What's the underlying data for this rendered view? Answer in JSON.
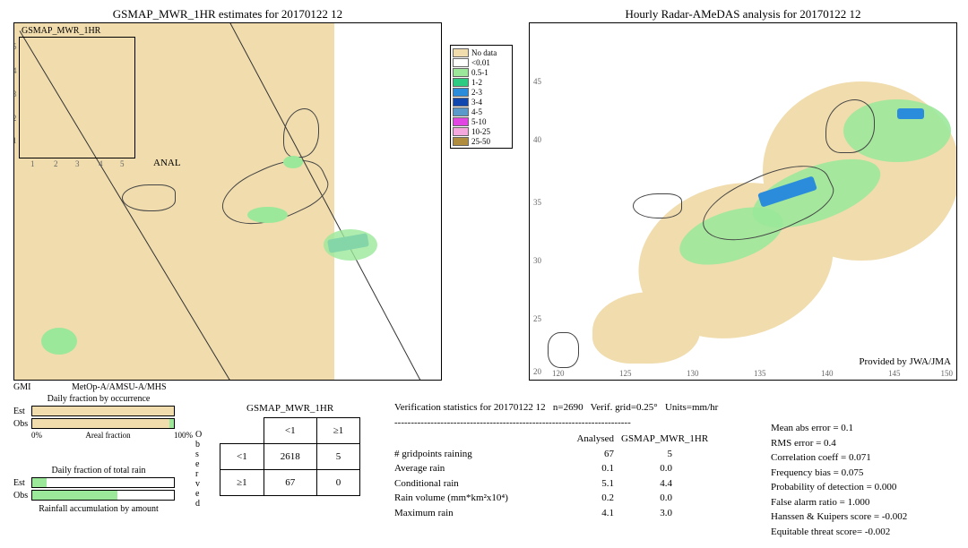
{
  "left_map": {
    "title": "GSMAP_MWR_1HR estimates for 20170122 12",
    "inset_label": "GSMAP_MWR_1HR",
    "anal_label": "ANAL",
    "footer_left": "GMI",
    "footer_right": "MetOp-A/AMSU-A/MHS"
  },
  "right_map": {
    "title": "Hourly Radar-AMeDAS analysis for 20170122 12",
    "lat_ticks": [
      "45",
      "40",
      "35",
      "30",
      "25",
      "20"
    ],
    "lon_ticks": [
      "120",
      "125",
      "130",
      "135",
      "140",
      "145",
      "150"
    ],
    "provided": "Provided by JWA/JMA"
  },
  "legend": {
    "items": [
      {
        "color": "#f0dcad",
        "label": "No data"
      },
      {
        "color": "#ffffff",
        "label": "<0.01"
      },
      {
        "color": "#9be89b",
        "label": "0.5-1"
      },
      {
        "color": "#2ecc82",
        "label": "1-2"
      },
      {
        "color": "#2b8cdb",
        "label": "2-3"
      },
      {
        "color": "#1148b0",
        "label": "3-4"
      },
      {
        "color": "#5a9acb",
        "label": "4-5"
      },
      {
        "color": "#e246e2",
        "label": "5-10"
      },
      {
        "color": "#f5a8de",
        "label": "10-25"
      },
      {
        "color": "#b08c3e",
        "label": "25-50"
      }
    ]
  },
  "bars": {
    "title1": "Daily fraction by occurrence",
    "title2": "Daily fraction of total rain",
    "caption3": "Rainfall accumulation by amount",
    "est_label": "Est",
    "obs_label": "Obs",
    "x0": "0%",
    "x1": "Areal fraction",
    "x100": "100%"
  },
  "contingency": {
    "title": "GSMAP_MWR_1HR",
    "col1": "<1",
    "col2": "≥1",
    "row1": "<1",
    "row2": "≥1",
    "c11": "2618",
    "c12": "5",
    "c21": "67",
    "c22": "0",
    "observed": "Observed"
  },
  "stats": {
    "header": "Verification statistics for 20170122 12   n=2690   Verif. grid=0.25°   Units=mm/hr",
    "dash": "------------------------------------------------------------------------",
    "col_analysed": "Analysed",
    "col_gsmap": "GSMAP_MWR_1HR",
    "rows": [
      {
        "label": "# gridpoints raining",
        "a": "67",
        "b": "5"
      },
      {
        "label": "Average rain",
        "a": "0.1",
        "b": "0.0"
      },
      {
        "label": "Conditional rain",
        "a": "5.1",
        "b": "4.4"
      },
      {
        "label": "Rain volume (mm*km²x10⁴)",
        "a": "0.2",
        "b": "0.0"
      },
      {
        "label": "Maximum rain",
        "a": "4.1",
        "b": "3.0"
      }
    ]
  },
  "metrics": {
    "items": [
      "Mean abs error = 0.1",
      "RMS error = 0.4",
      "Correlation coeff = 0.071",
      "Frequency bias = 0.075",
      "Probability of detection = 0.000",
      "False alarm ratio = 1.000",
      "Hanssen & Kuipers score = -0.002",
      "Equitable threat score= -0.002"
    ]
  },
  "chart_data": {
    "type": "table",
    "title": "Verification contingency and statistics",
    "contingency": {
      "rows": [
        "<1",
        "≥1"
      ],
      "cols": [
        "<1",
        "≥1"
      ],
      "values": [
        [
          2618,
          5
        ],
        [
          67,
          0
        ]
      ]
    },
    "series": [
      {
        "name": "# gridpoints raining",
        "Analysed": 67,
        "GSMAP_MWR_1HR": 5
      },
      {
        "name": "Average rain",
        "Analysed": 0.1,
        "GSMAP_MWR_1HR": 0.0
      },
      {
        "name": "Conditional rain",
        "Analysed": 5.1,
        "GSMAP_MWR_1HR": 4.4
      },
      {
        "name": "Rain volume (mm*km²x10⁴)",
        "Analysed": 0.2,
        "GSMAP_MWR_1HR": 0.0
      },
      {
        "name": "Maximum rain",
        "Analysed": 4.1,
        "GSMAP_MWR_1HR": 3.0
      }
    ],
    "metrics": {
      "Mean abs error": 0.1,
      "RMS error": 0.4,
      "Correlation coeff": 0.071,
      "Frequency bias": 0.075,
      "Probability of detection": 0.0,
      "False alarm ratio": 1.0,
      "Hanssen & Kuipers score": -0.002,
      "Equitable threat score": -0.002
    }
  }
}
